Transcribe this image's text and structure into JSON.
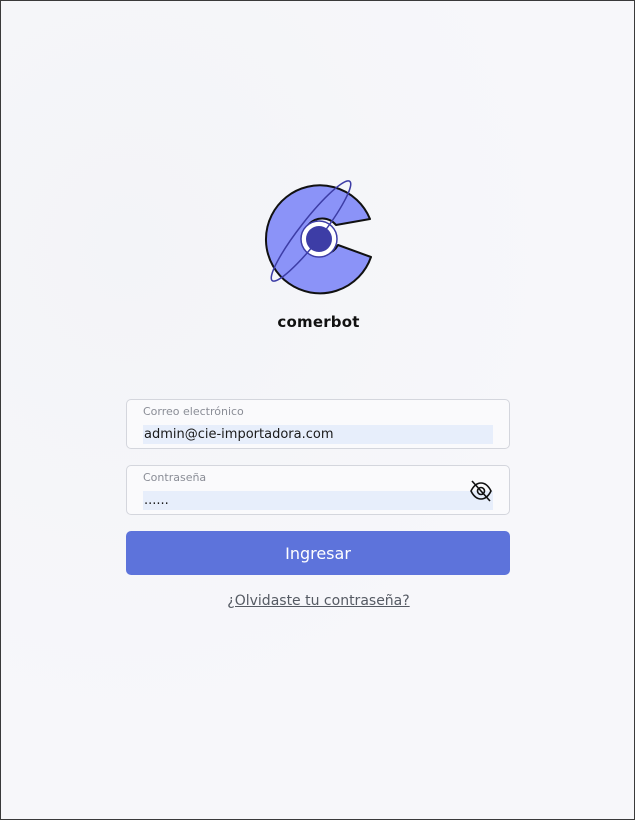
{
  "brand": {
    "name": "comerbot",
    "logo_colors": {
      "body": "#8b93f8",
      "core": "#3d3da6",
      "outline": "#111111"
    }
  },
  "form": {
    "email": {
      "label": "Correo electrónico",
      "value": "admin@cie-importadora.com"
    },
    "password": {
      "label": "Contraseña",
      "value": "......",
      "toggle_icon": "eye-slash-icon"
    },
    "submit_label": "Ingresar",
    "forgot_link": "¿Olvidaste tu contraseña?"
  },
  "colors": {
    "accent": "#5d73db",
    "background": "#f6f6fa",
    "autofill": "#e7eefb"
  }
}
